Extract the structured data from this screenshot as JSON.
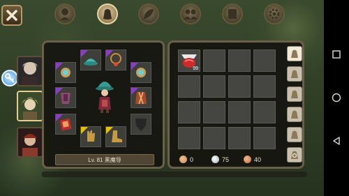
{
  "character": {
    "level_class": "Lv. 81 黑魔导"
  },
  "inventory": {
    "first_item_qty": "99"
  },
  "currency": [
    {
      "name": "copper-coin",
      "amount": "0",
      "color": "#c98b56"
    },
    {
      "name": "silver-coin",
      "amount": "75",
      "color": "#c0c4c8"
    },
    {
      "name": "gold-coin",
      "amount": "40",
      "color": "#d08a5a"
    }
  ],
  "colors": {
    "rarity_purple": "#8a3ec8",
    "rarity_yellow": "#e6c300",
    "panel_border": "#6b5f4a"
  }
}
